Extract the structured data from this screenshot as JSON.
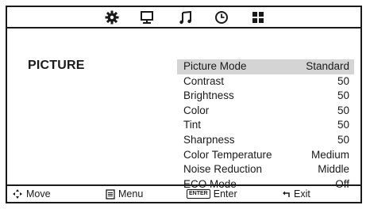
{
  "top_icons": [
    "settings-icon",
    "monitor-icon",
    "music-note-icon",
    "clock-icon",
    "grid-icon"
  ],
  "section_title": "PICTURE",
  "menu": [
    {
      "label": "Picture Mode",
      "value": "Standard",
      "selected": true
    },
    {
      "label": "Contrast",
      "value": "50"
    },
    {
      "label": "Brightness",
      "value": "50"
    },
    {
      "label": "Color",
      "value": "50"
    },
    {
      "label": "Tint",
      "value": "50"
    },
    {
      "label": "Sharpness",
      "value": "50"
    },
    {
      "label": "Color Temperature",
      "value": "Medium"
    },
    {
      "label": "Noise Reduction",
      "value": "Middle"
    },
    {
      "label": "ECO Mode",
      "value": "Off"
    }
  ],
  "footer": {
    "move": "Move",
    "menu": "Menu",
    "enter_key": "ENTER",
    "enter": "Enter",
    "exit": "Exit"
  },
  "colors": {
    "selected_row": "#d4d4d4",
    "foreground": "#1a1a1a"
  }
}
